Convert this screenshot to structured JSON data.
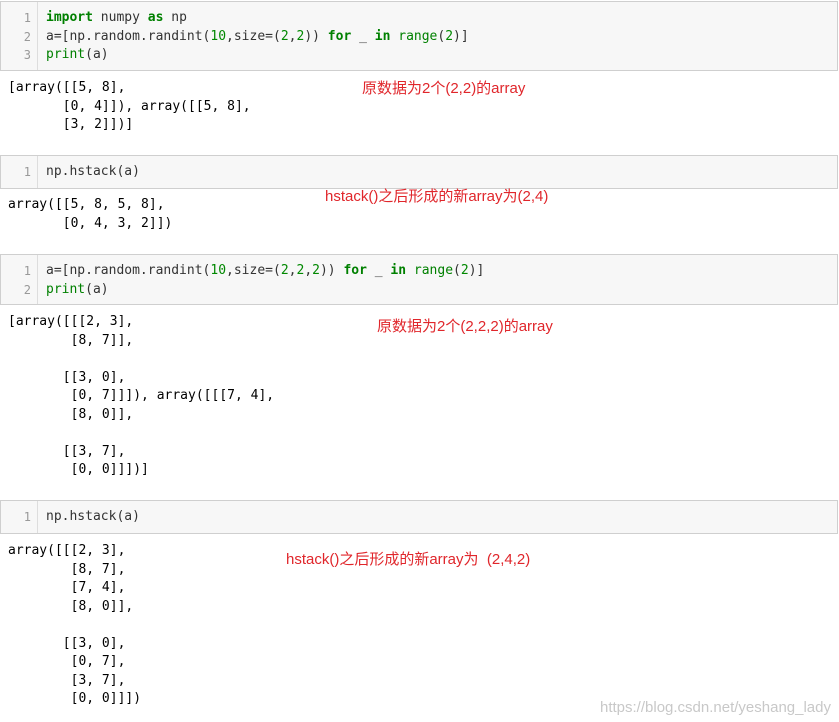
{
  "cells": [
    {
      "id": "cell1",
      "lines": [
        {
          "n": "1",
          "tokens": [
            {
              "t": "import",
              "k": "kw"
            },
            {
              "t": " numpy ",
              "k": ""
            },
            {
              "t": "as",
              "k": "kw"
            },
            {
              "t": " np",
              "k": ""
            }
          ]
        },
        {
          "n": "2",
          "tokens": [
            {
              "t": "a=[np.random.randint(",
              "k": ""
            },
            {
              "t": "10",
              "k": "num"
            },
            {
              "t": ",size=(",
              "k": ""
            },
            {
              "t": "2",
              "k": "num"
            },
            {
              "t": ",",
              "k": ""
            },
            {
              "t": "2",
              "k": "num"
            },
            {
              "t": ")) ",
              "k": ""
            },
            {
              "t": "for",
              "k": "kw"
            },
            {
              "t": " _ ",
              "k": ""
            },
            {
              "t": "in",
              "k": "kw"
            },
            {
              "t": " ",
              "k": ""
            },
            {
              "t": "range",
              "k": "bi"
            },
            {
              "t": "(",
              "k": ""
            },
            {
              "t": "2",
              "k": "num"
            },
            {
              "t": ")]",
              "k": ""
            }
          ]
        },
        {
          "n": "3",
          "tokens": [
            {
              "t": "print",
              "k": "bi"
            },
            {
              "t": "(a)",
              "k": ""
            }
          ]
        }
      ],
      "output": "[array([[5, 8],\n       [0, 4]]), array([[5, 8],\n       [3, 2]])]",
      "note": "原数据为2个(2,2)的array"
    },
    {
      "id": "cell2",
      "lines": [
        {
          "n": "1",
          "tokens": [
            {
              "t": "np.hstack(a)",
              "k": ""
            }
          ]
        }
      ],
      "output": "array([[5, 8, 5, 8],\n       [0, 4, 3, 2]])",
      "note": "hstack()之后形成的新array为(2,4)"
    },
    {
      "id": "cell3",
      "lines": [
        {
          "n": "1",
          "tokens": [
            {
              "t": "a=[np.random.randint(",
              "k": ""
            },
            {
              "t": "10",
              "k": "num"
            },
            {
              "t": ",size=(",
              "k": ""
            },
            {
              "t": "2",
              "k": "num"
            },
            {
              "t": ",",
              "k": ""
            },
            {
              "t": "2",
              "k": "num"
            },
            {
              "t": ",",
              "k": ""
            },
            {
              "t": "2",
              "k": "num"
            },
            {
              "t": ")) ",
              "k": ""
            },
            {
              "t": "for",
              "k": "kw"
            },
            {
              "t": " _ ",
              "k": ""
            },
            {
              "t": "in",
              "k": "kw"
            },
            {
              "t": " ",
              "k": ""
            },
            {
              "t": "range",
              "k": "bi"
            },
            {
              "t": "(",
              "k": ""
            },
            {
              "t": "2",
              "k": "num"
            },
            {
              "t": ")]",
              "k": ""
            }
          ]
        },
        {
          "n": "2",
          "tokens": [
            {
              "t": "print",
              "k": "bi"
            },
            {
              "t": "(a)",
              "k": ""
            }
          ]
        }
      ],
      "output": "[array([[[2, 3],\n        [8, 7]],\n\n       [[3, 0],\n        [0, 7]]]), array([[[7, 4],\n        [8, 0]],\n\n       [[3, 7],\n        [0, 0]]])]",
      "note": "原数据为2个(2,2,2)的array"
    },
    {
      "id": "cell4",
      "lines": [
        {
          "n": "1",
          "tokens": [
            {
              "t": "np.hstack(a)",
              "k": ""
            }
          ]
        }
      ],
      "output": "array([[[2, 3],\n        [8, 7],\n        [7, 4],\n        [8, 0]],\n\n       [[3, 0],\n        [0, 7],\n        [3, 7],\n        [0, 0]]])",
      "note": "hstack()之后形成的新array为  (2,4,2)"
    }
  ],
  "watermark": "https://blog.csdn.net/yeshang_lady",
  "colors": {
    "keyword": "#008000",
    "annotation": "#e0262b",
    "cell_bg": "#f7f7f7"
  }
}
